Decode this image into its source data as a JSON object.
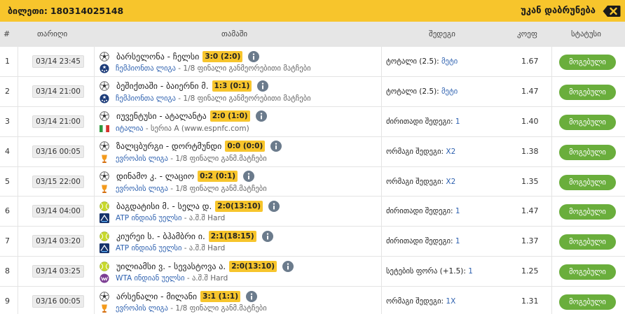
{
  "header": {
    "ticket_label": "ბილეთი:",
    "ticket_number": "180314025148",
    "back_label": "უკან დაბრუნება",
    "back_icon": "backspace-close-icon"
  },
  "columns": {
    "num": "#",
    "date": "თარიღი",
    "match": "თამაში",
    "bet": "შედეგი",
    "odds": "კოეფ",
    "status": "სტატუსი"
  },
  "colors": {
    "accent": "#f7c52c",
    "status_green": "#6aae3c",
    "link_blue": "#2f62b0",
    "header_gray": "#e6e6e6"
  },
  "rows": [
    {
      "num": "1",
      "date": "03/14 23:45",
      "teams": "ბარსელონა - ჩელსი",
      "score": "3:0 (2:0)",
      "sport_icon": "football-icon",
      "league_icon": "champions-league-icon",
      "league": "ჩემპიონთა ლიგა",
      "stage": " - 1/8 ფინალი განმეორებითი მატჩები",
      "bet_label": "ტოტალი (2.5): ",
      "bet_value": "მეტი",
      "odds": "1.67",
      "status": "მოგებული"
    },
    {
      "num": "2",
      "date": "03/14 21:00",
      "teams": "ბეშიქთაში - ბაიერნი მ.",
      "score": "1:3 (0:1)",
      "sport_icon": "football-icon",
      "league_icon": "champions-league-icon",
      "league": "ჩემპიონთა ლიგა",
      "stage": " - 1/8 ფინალი განმეორებითი მატჩები",
      "bet_label": "ტოტალი (2.5): ",
      "bet_value": "მეტი",
      "odds": "1.47",
      "status": "მოგებული"
    },
    {
      "num": "3",
      "date": "03/14 21:00",
      "teams": "იუვენტუსი - ატალანტა",
      "score": "2:0 (1:0)",
      "sport_icon": "football-icon",
      "league_icon": "italy-flag-icon",
      "league": "იტალია",
      "stage": " - სერია A (www.espnfc.com)",
      "bet_label": "ძირითადი შედეგი: ",
      "bet_value": "1",
      "odds": "1.40",
      "status": "მოგებული"
    },
    {
      "num": "4",
      "date": "03/16 00:05",
      "teams": "ზალცბურგი - დორტმუნდი",
      "score": "0:0 (0:0)",
      "sport_icon": "football-icon",
      "league_icon": "europa-league-icon",
      "league": "ევროპის ლიგა",
      "stage": " - 1/8 ფინალი განმ.მატჩები",
      "bet_label": "ორმაგი შედეგი: ",
      "bet_value": "X2",
      "odds": "1.38",
      "status": "მოგებული"
    },
    {
      "num": "5",
      "date": "03/15 22:00",
      "teams": "დინამო კ. - ლაციო",
      "score": "0:2 (0:1)",
      "sport_icon": "football-icon",
      "league_icon": "europa-league-icon",
      "league": "ევროპის ლიგა",
      "stage": " - 1/8 ფინალი განმ.მატჩები",
      "bet_label": "ორმაგი შედეგი: ",
      "bet_value": "X2",
      "odds": "1.35",
      "status": "მოგებული"
    },
    {
      "num": "6",
      "date": "03/14 04:00",
      "teams": "ბაგდატისი მ. - სელა დ.",
      "score": "2:0(13:10)",
      "sport_icon": "tennis-ball-icon",
      "league_icon": "atp-icon",
      "league": "ATP ინდიან უელსი",
      "stage": " - ა.შ.შ Hard",
      "bet_label": "ძირითადი შედეგი: ",
      "bet_value": "1",
      "odds": "1.47",
      "status": "მოგებული"
    },
    {
      "num": "7",
      "date": "03/14 03:20",
      "teams": "კიურეი ს. - ბჰამბრი ი.",
      "score": "2:1(18:15)",
      "sport_icon": "tennis-ball-icon",
      "league_icon": "atp-icon",
      "league": "ATP ინდიან უელსი",
      "stage": " - ა.შ.შ Hard",
      "bet_label": "ძირითადი შედეგი: ",
      "bet_value": "1",
      "odds": "1.37",
      "status": "მოგებული"
    },
    {
      "num": "8",
      "date": "03/14 03:25",
      "teams": "უილიამსი ვ. - სევასტოვა ა.",
      "score": "2:0(13:10)",
      "sport_icon": "tennis-ball-icon",
      "league_icon": "wta-icon",
      "league": "WTA ინდიან უელსი",
      "stage": " - ა.შ.შ Hard",
      "bet_label": "სეტების ფორა (+1.5): ",
      "bet_value": "1",
      "odds": "1.25",
      "status": "მოგებული"
    },
    {
      "num": "9",
      "date": "03/16 00:05",
      "teams": "არსენალი - მილანი",
      "score": "3:1 (1:1)",
      "sport_icon": "football-icon",
      "league_icon": "europa-league-icon",
      "league": "ევროპის ლიგა",
      "stage": " - 1/8 ფინალი განმ.მატჩები",
      "bet_label": "ორმაგი შედეგი: ",
      "bet_value": "1X",
      "odds": "1.31",
      "status": "მოგებული"
    }
  ]
}
